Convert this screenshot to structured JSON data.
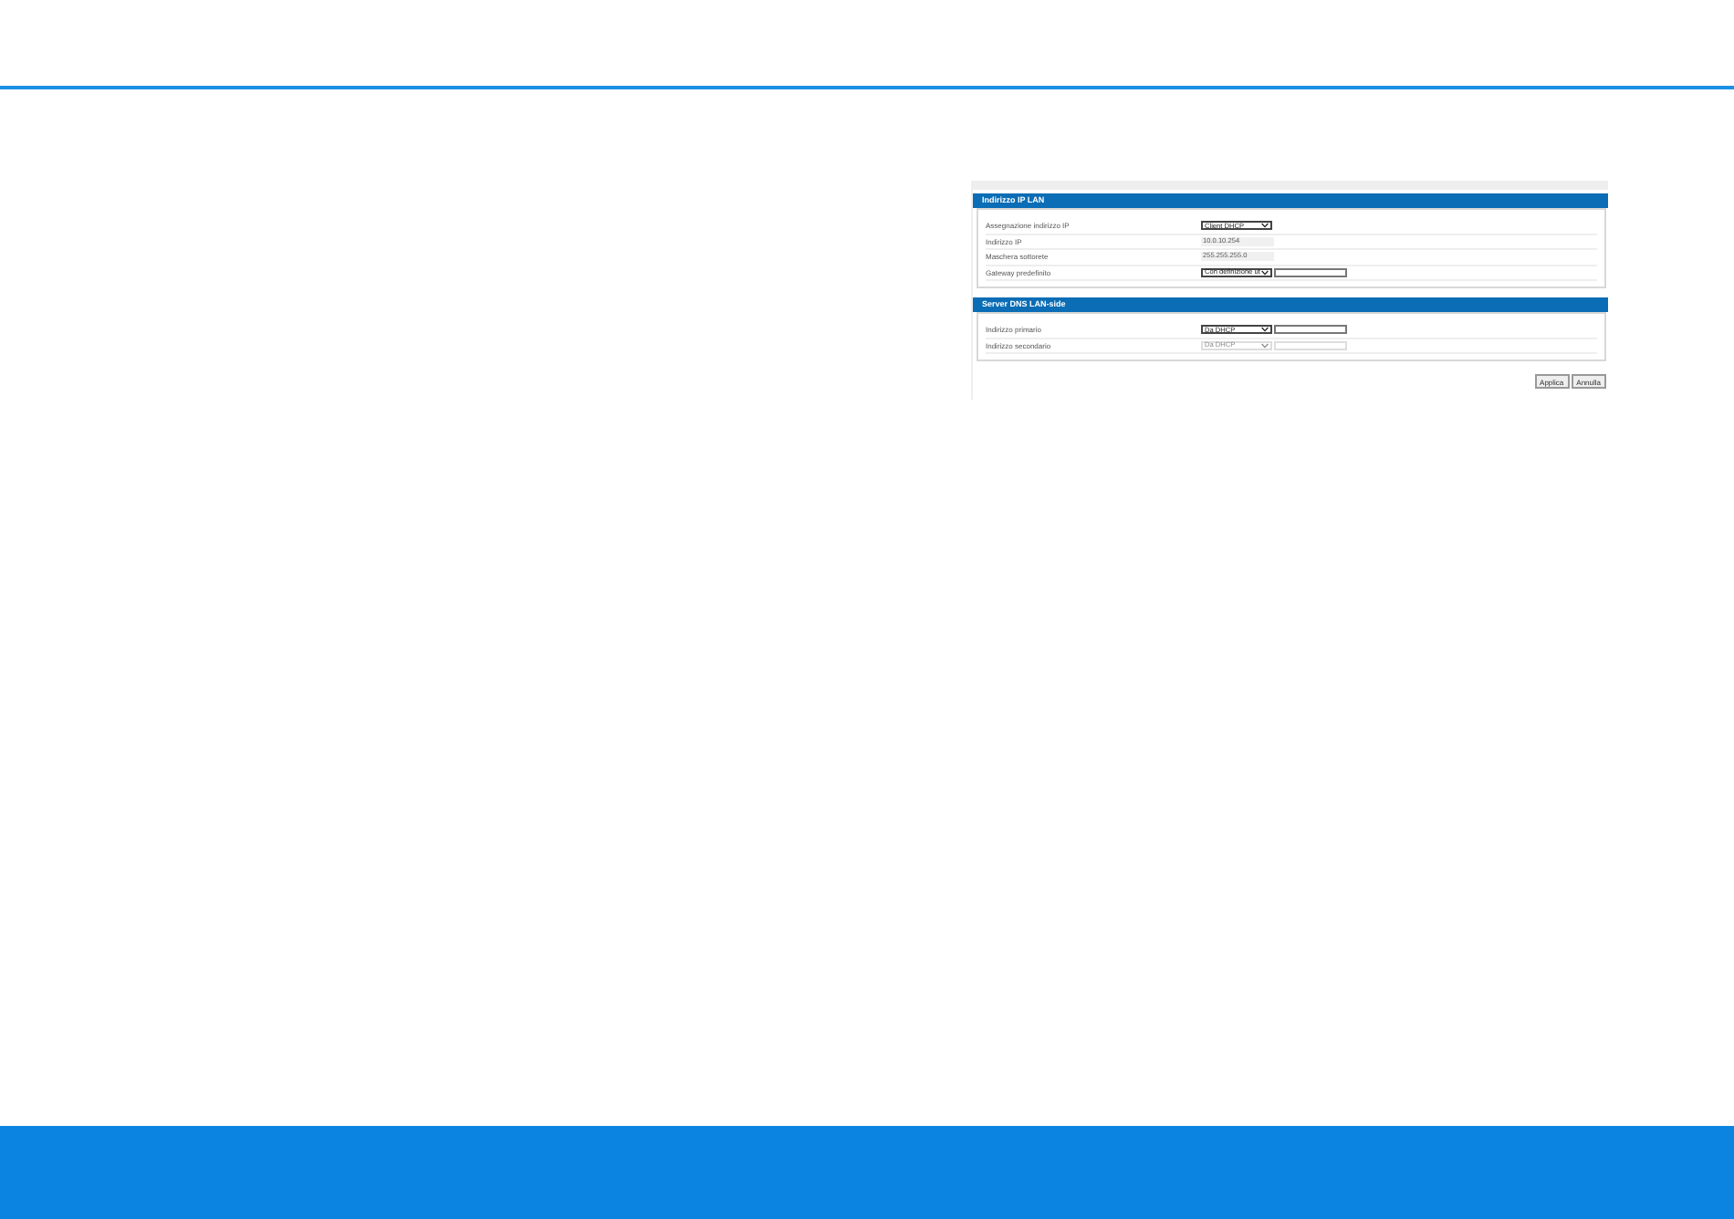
{
  "sections": [
    {
      "title": "Indirizzo IP LAN",
      "rows": [
        {
          "label": "Assegnazione indirizzo IP",
          "kind": "select",
          "value": "Client DHCP",
          "disabled": false,
          "extra_field": false
        },
        {
          "label": "Indirizzo IP",
          "kind": "readonly",
          "value": "10.0.10.254"
        },
        {
          "label": "Maschera sottorete",
          "kind": "readonly",
          "value": "255.255.255.0"
        },
        {
          "label": "Gateway predefinito",
          "kind": "select",
          "value": "Con definizione ut",
          "disabled": false,
          "extra_field": true
        }
      ]
    },
    {
      "title": "Server DNS LAN-side",
      "rows": [
        {
          "label": "Indirizzo primario",
          "kind": "select",
          "value": "Da DHCP",
          "disabled": false,
          "extra_field": true
        },
        {
          "label": "Indirizzo secondario",
          "kind": "select",
          "value": "Da DHCP",
          "disabled": true,
          "extra_field": true
        }
      ]
    }
  ],
  "buttons": [
    "Applica",
    "Annulla"
  ]
}
